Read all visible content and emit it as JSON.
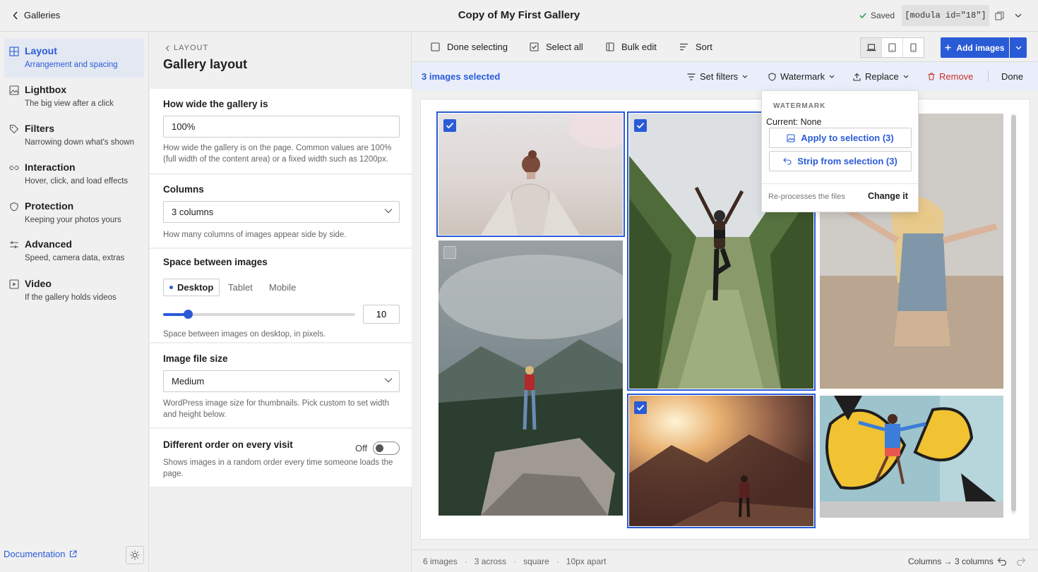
{
  "topbar": {
    "back_label": "Galleries",
    "title": "Copy of My First Gallery",
    "saved_label": "Saved",
    "shortcode": "[modula id=\"18\"]"
  },
  "sidebar": {
    "items": [
      {
        "label": "Layout",
        "sub": "Arrangement and spacing",
        "icon": "grid-icon",
        "active": true
      },
      {
        "label": "Lightbox",
        "sub": "The big view after a click",
        "icon": "image-icon"
      },
      {
        "label": "Filters",
        "sub": "Narrowing down what's shown",
        "icon": "tag-icon"
      },
      {
        "label": "Interaction",
        "sub": "Hover, click, and load effects",
        "icon": "link-icon"
      },
      {
        "label": "Protection",
        "sub": "Keeping your photos yours",
        "icon": "shield-icon"
      },
      {
        "label": "Advanced",
        "sub": "Speed, camera data, extras",
        "icon": "sliders-icon"
      },
      {
        "label": "Video",
        "sub": "If the gallery holds videos",
        "icon": "play-icon"
      }
    ],
    "documentation_label": "Documentation"
  },
  "settings": {
    "breadcrumb": "LAYOUT",
    "title": "Gallery layout",
    "width": {
      "label": "How wide the gallery is",
      "value": "100%",
      "help": "How wide the gallery is on the page. Common values are 100% (full width of the content area) or a fixed width such as 1200px."
    },
    "columns": {
      "label": "Columns",
      "value": "3 columns",
      "help": "How many columns of images appear side by side."
    },
    "spacing": {
      "label": "Space between images",
      "tabs": [
        "Desktop",
        "Tablet",
        "Mobile"
      ],
      "active_tab": "Desktop",
      "value": "10",
      "slider_fraction": 0.13,
      "help": "Space between images on desktop, in pixels."
    },
    "file_size": {
      "label": "Image file size",
      "value": "Medium",
      "help": "WordPress image size for thumbnails. Pick custom to set width and height below."
    },
    "random_order": {
      "label": "Different order on every visit",
      "state": "Off",
      "help": "Shows images in a random order every time someone loads the page."
    }
  },
  "toolbar": {
    "done_selecting": "Done selecting",
    "select_all": "Select all",
    "bulk_edit": "Bulk edit",
    "sort": "Sort",
    "add_images": "Add images",
    "active_device": "desktop"
  },
  "selection_bar": {
    "count_label": "3 images selected",
    "set_filters": "Set filters",
    "watermark": "Watermark",
    "replace": "Replace",
    "remove": "Remove",
    "done": "Done"
  },
  "watermark_menu": {
    "heading": "WATERMARK",
    "current": "Current: None",
    "apply": "Apply to selection (3)",
    "strip": "Strip from selection (3)",
    "note": "Re-processes the files",
    "change": "Change it"
  },
  "gallery": {
    "photos": [
      {
        "subject": "woman-foggy-beach",
        "selected": true
      },
      {
        "subject": "woman-yoga-vineyard",
        "selected": true
      },
      {
        "subject": "blonde-woman-outdoors",
        "selected": false
      },
      {
        "subject": "hiker-cliff-forest",
        "selected": false
      },
      {
        "subject": "man-sunset-mountains",
        "selected": true
      },
      {
        "subject": "woman-butterfly-mural",
        "selected": false
      }
    ]
  },
  "statusbar": {
    "items": [
      "6 images",
      "3 across",
      "square",
      "10px apart"
    ],
    "summary": "Columns → 3 columns"
  },
  "colors": {
    "accent": "#2a5bd7",
    "danger": "#c9302c",
    "selection_bg": "#e9eefa"
  }
}
